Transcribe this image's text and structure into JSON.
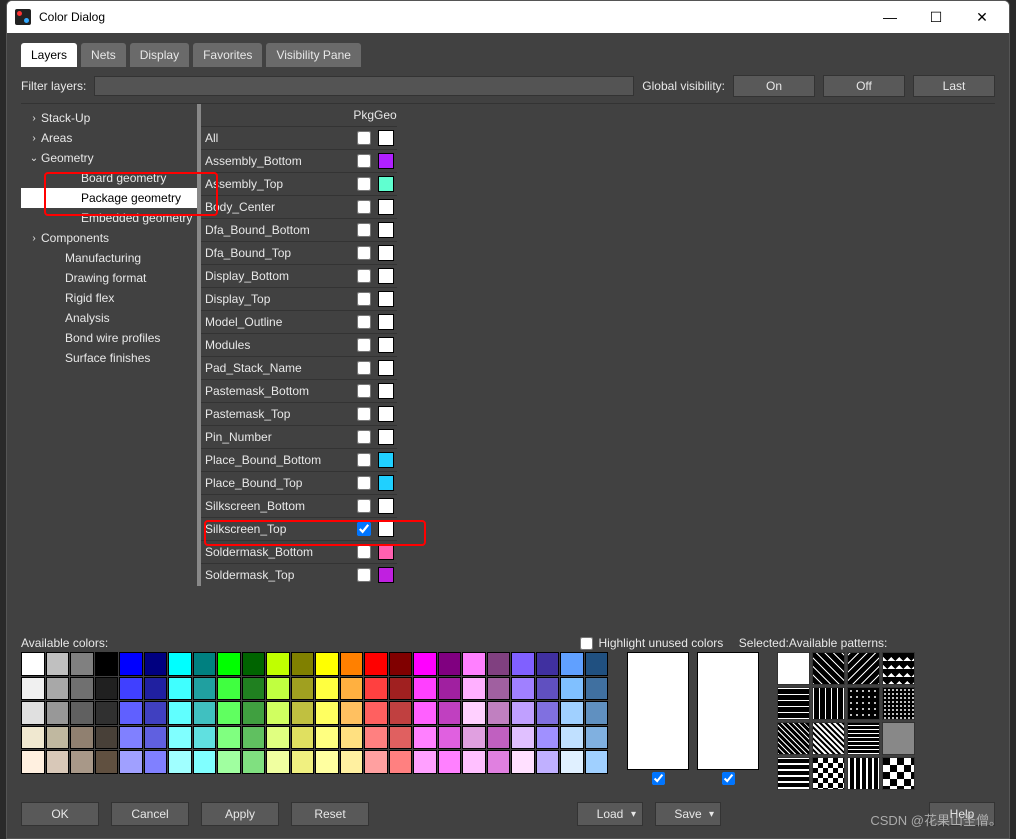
{
  "window": {
    "title": "Color Dialog"
  },
  "tabs": [
    "Layers",
    "Nets",
    "Display",
    "Favorites",
    "Visibility Pane"
  ],
  "active_tab": 0,
  "filter": {
    "label": "Filter layers:",
    "value": ""
  },
  "global_visibility": {
    "label": "Global visibility:",
    "buttons": [
      "On",
      "Off",
      "Last"
    ]
  },
  "tree": [
    {
      "label": "Stack-Up",
      "level": 0,
      "caret": "›"
    },
    {
      "label": "Areas",
      "level": 0,
      "caret": "›"
    },
    {
      "label": "Geometry",
      "level": 0,
      "caret": "⌄"
    },
    {
      "label": "Board geometry",
      "level": 2,
      "caret": ""
    },
    {
      "label": "Package geometry",
      "level": 2,
      "caret": "",
      "selected": true
    },
    {
      "label": "Embedded geometry",
      "level": 2,
      "caret": ""
    },
    {
      "label": "Components",
      "level": 0,
      "caret": "›"
    },
    {
      "label": "Manufacturing",
      "level": 1,
      "caret": ""
    },
    {
      "label": "Drawing format",
      "level": 1,
      "caret": ""
    },
    {
      "label": "Rigid flex",
      "level": 1,
      "caret": ""
    },
    {
      "label": "Analysis",
      "level": 1,
      "caret": ""
    },
    {
      "label": "Bond wire profiles",
      "level": 1,
      "caret": ""
    },
    {
      "label": "Surface finishes",
      "level": 1,
      "caret": ""
    }
  ],
  "layer_header": "PkgGeo",
  "layers": [
    {
      "name": "All",
      "checked": false,
      "color": "#ffffff"
    },
    {
      "name": "Assembly_Bottom",
      "checked": false,
      "color": "#b020ff"
    },
    {
      "name": "Assembly_Top",
      "checked": false,
      "color": "#60ffd0"
    },
    {
      "name": "Body_Center",
      "checked": false,
      "color": "#ffffff"
    },
    {
      "name": "Dfa_Bound_Bottom",
      "checked": false,
      "color": "#ffffff"
    },
    {
      "name": "Dfa_Bound_Top",
      "checked": false,
      "color": "#ffffff"
    },
    {
      "name": "Display_Bottom",
      "checked": false,
      "color": "#ffffff"
    },
    {
      "name": "Display_Top",
      "checked": false,
      "color": "#ffffff"
    },
    {
      "name": "Model_Outline",
      "checked": false,
      "color": "#ffffff"
    },
    {
      "name": "Modules",
      "checked": false,
      "color": "#ffffff"
    },
    {
      "name": "Pad_Stack_Name",
      "checked": false,
      "color": "#ffffff"
    },
    {
      "name": "Pastemask_Bottom",
      "checked": false,
      "color": "#ffffff"
    },
    {
      "name": "Pastemask_Top",
      "checked": false,
      "color": "#ffffff"
    },
    {
      "name": "Pin_Number",
      "checked": false,
      "color": "#ffffff"
    },
    {
      "name": "Place_Bound_Bottom",
      "checked": false,
      "color": "#20d0ff"
    },
    {
      "name": "Place_Bound_Top",
      "checked": false,
      "color": "#20d0ff"
    },
    {
      "name": "Silkscreen_Bottom",
      "checked": false,
      "color": "#ffffff"
    },
    {
      "name": "Silkscreen_Top",
      "checked": true,
      "color": "#ffffff"
    },
    {
      "name": "Soldermask_Bottom",
      "checked": false,
      "color": "#ff60b0"
    },
    {
      "name": "Soldermask_Top",
      "checked": false,
      "color": "#c020e0"
    }
  ],
  "available_colors_label": "Available colors:",
  "highlight_unused_label": "Highlight unused colors",
  "highlight_unused_checked": false,
  "selected_label": "Selected:",
  "available_patterns_label": "Available patterns:",
  "palette_colors": [
    "#ffffff",
    "#c0c0c0",
    "#808080",
    "#000000",
    "#0000ff",
    "#000080",
    "#00ffff",
    "#008080",
    "#00ff00",
    "#006400",
    "#c0ff00",
    "#808000",
    "#ffff00",
    "#ff8000",
    "#ff0000",
    "#800000",
    "#ff00ff",
    "#800080",
    "#ff80ff",
    "#804080",
    "#8060ff",
    "#4030a0",
    "#60a0ff",
    "#205080",
    "#f0f0f0",
    "#a8a8a8",
    "#707070",
    "#202020",
    "#4040ff",
    "#2020a0",
    "#40ffff",
    "#20a0a0",
    "#40ff40",
    "#208020",
    "#c0ff40",
    "#a0a020",
    "#ffff40",
    "#ffb040",
    "#ff4040",
    "#a02020",
    "#ff40ff",
    "#a020a0",
    "#ffb0ff",
    "#a060a0",
    "#a080ff",
    "#6050c0",
    "#80c0ff",
    "#4070a0",
    "#e0e0e0",
    "#989898",
    "#606060",
    "#303030",
    "#6060ff",
    "#4040c0",
    "#60ffff",
    "#40c0c0",
    "#60ff60",
    "#40a040",
    "#d0ff60",
    "#c0c040",
    "#ffff60",
    "#ffc060",
    "#ff6060",
    "#c04040",
    "#ff60ff",
    "#c040c0",
    "#ffd0ff",
    "#c080c0",
    "#c0a0ff",
    "#8070e0",
    "#a0d0ff",
    "#6090c0",
    "#f0e8d0",
    "#c0b8a0",
    "#908070",
    "#484038",
    "#8080ff",
    "#6060e0",
    "#80ffff",
    "#60e0e0",
    "#80ff80",
    "#60c060",
    "#e0ff80",
    "#e0e060",
    "#ffff80",
    "#ffe080",
    "#ff8080",
    "#e06060",
    "#ff80ff",
    "#e060e0",
    "#e0a0e0",
    "#c060c0",
    "#e0c0ff",
    "#a090ff",
    "#c0e0ff",
    "#80b0e0",
    "#fff0e0",
    "#d8c8b8",
    "#a89888",
    "#605040",
    "#a0a0ff",
    "#8080ff",
    "#a0ffff",
    "#80ffff",
    "#a0ffa0",
    "#80e080",
    "#f0ffa0",
    "#f0f080",
    "#ffffa0",
    "#fff0a0",
    "#ffa0a0",
    "#ff8080",
    "#ffa0ff",
    "#ff80ff",
    "#ffc0ff",
    "#e080e0",
    "#ffe0ff",
    "#c0b0ff",
    "#e0f0ff",
    "#a0d0ff"
  ],
  "patterns_count": 16,
  "selected_boxes": [
    {
      "checked": true
    },
    {
      "checked": true
    }
  ],
  "buttons": {
    "ok": "OK",
    "cancel": "Cancel",
    "apply": "Apply",
    "reset": "Reset",
    "load": "Load",
    "save": "Save",
    "help": "Help"
  },
  "watermark": "CSDN @花果山圣僧。"
}
